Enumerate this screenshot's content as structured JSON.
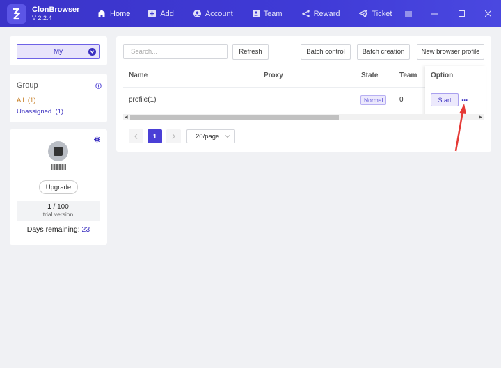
{
  "app": {
    "name": "ClonBrowser",
    "version": "V 2.2.4"
  },
  "nav": {
    "items": [
      {
        "label": "Home",
        "icon": "home-icon"
      },
      {
        "label": "Add",
        "icon": "plus-square-icon"
      },
      {
        "label": "Account",
        "icon": "user-circle-icon"
      },
      {
        "label": "Team",
        "icon": "id-card-icon"
      },
      {
        "label": "Reward",
        "icon": "share-icon"
      },
      {
        "label": "Ticket",
        "icon": "paper-plane-icon"
      }
    ]
  },
  "sidebar": {
    "selector": {
      "value": "My"
    },
    "group": {
      "title": "Group",
      "all_label": "All",
      "all_count": "(1)",
      "unassigned_label": "Unassigned",
      "unassigned_count": "(1)"
    },
    "account": {
      "upgrade_label": "Upgrade",
      "quota_used": "1",
      "quota_sep": " / ",
      "quota_total": "100",
      "plan": "trial version",
      "days_label": "Days remaining:",
      "days_value": "23"
    }
  },
  "main": {
    "search_placeholder": "Search...",
    "buttons": {
      "refresh": "Refresh",
      "batch_control": "Batch control",
      "batch_creation": "Batch creation",
      "new_profile": "New browser profile"
    },
    "columns": {
      "name": "Name",
      "proxy": "Proxy",
      "state": "State",
      "team": "Team",
      "option": "Option"
    },
    "rows": [
      {
        "name": "profile(1)",
        "proxy": "",
        "state": "Normal",
        "team": "0",
        "start": "Start",
        "more": "···"
      }
    ],
    "pagination": {
      "current": "1",
      "page_size": "20/page"
    }
  },
  "colors": {
    "accent": "#3f3ad6",
    "brand_purple": "#3b30c0",
    "annotation_arrow": "#e53935"
  }
}
